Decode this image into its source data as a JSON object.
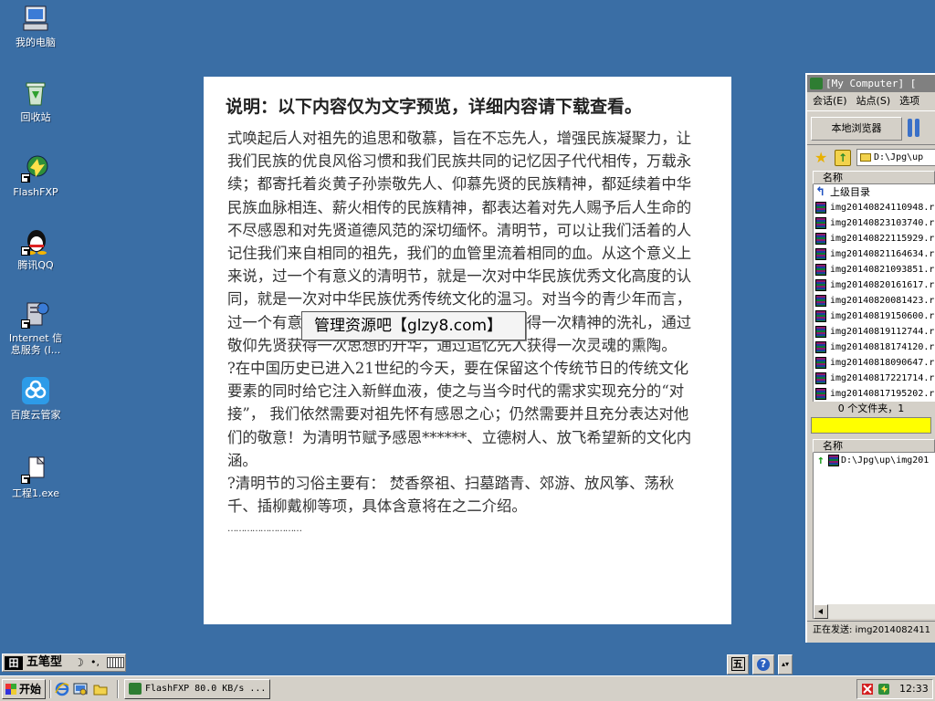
{
  "desktop": {
    "icons": [
      {
        "label": "我的电脑"
      },
      {
        "label": "回收站"
      },
      {
        "label": "FlashFXP"
      },
      {
        "label": "腾讯QQ"
      },
      {
        "label_line1": "Internet 信",
        "label_line2": "息服务 (I..."
      },
      {
        "label": "百度云管家"
      },
      {
        "label": "工程1.exe"
      }
    ]
  },
  "document": {
    "title": "说明：以下内容仅为文字预览，详细内容请下载查看。",
    "paragraphs": [
      "式唤起后人对祖先的追思和敬慕，旨在不忘先人，增强民族凝聚力，让我们民族的优良风俗习惯和我们民族共同的记忆因子代代相传，万载永续；都寄托着炎黄子孙崇敬先人、仰慕先贤的民族精神，都延续着中华民族血脉相连、薪火相传的民族精神，都表达着对先人赐予后人生命的不尽感恩和对先贤道德风范的深切缅怀。清明节，可以让我们活着的人记住我们来自相同的祖先，我们的血管里流着相同的血。从这个意义上来说，过一个有意义的清明节，就是一次对中华民族优秀文化高度的认同，就是一次对中华民族优秀传统文化的温习。对当今的青少年而言，过一个有意义的清明节，更是通过学习先烈获得一次精神的洗礼，通过敬仰先贤获得一次思想的升华，通过追忆先人获得一次灵魂的熏陶。",
      "?在中国历史已进入21世纪的今天，要在保留这个传统节日的传统文化要素的同时给它注入新鲜血液，使之与当今时代的需求实现充分的“对接”， 我们依然需要对祖先怀有感恩之心；仍然需要并且充分表达对他们的敬意！为清明节赋予感恩******、立德树人、放飞希望新的文化内涵。",
      "?清明节的习俗主要有： 焚香祭祖、扫墓踏青、郊游、放风筝、荡秋千、插柳戴柳等项，具体含意将在之二介绍。",
      "………………………"
    ],
    "watermark": "管理资源吧【glzy8.com】"
  },
  "ftp": {
    "title": "[My Computer]  [",
    "menu": [
      "会话(E)",
      "站点(S)",
      "选项"
    ],
    "browse_label": "本地浏览器",
    "path": "D:\\Jpg\\up",
    "column_name": "名称",
    "up_dir": "上级目录",
    "files": [
      "img20140824110948.r",
      "img20140823103740.r",
      "img20140822115929.r",
      "img20140821164634.r",
      "img20140821093851.r",
      "img20140820161617.r",
      "img20140820081423.r",
      "img20140819150600.r",
      "img20140819112744.r",
      "img20140818174120.r",
      "img20140818090647.r",
      "img20140817221714.r",
      "img20140817195202.r"
    ],
    "status": "0 个文件夹，1",
    "queue_column": "名称",
    "queue_item": "D:\\Jpg\\up\\img201",
    "sending": "正在发送: img2014082411"
  },
  "ime": {
    "name": "五笔型",
    "punct": "•,"
  },
  "lang_tray": {
    "wu": "五",
    "help": "?",
    "more": "▴▾"
  },
  "taskbar": {
    "start_label": "开始",
    "task_label": "FlashFXP 80.0 KB/s ...",
    "clock": "12:33"
  }
}
